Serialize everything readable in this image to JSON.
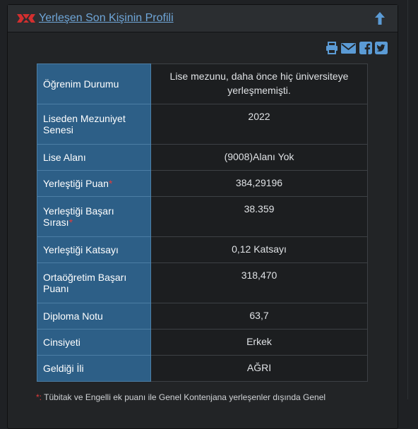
{
  "header": {
    "title": "Yerleşen Son Kişinin Profili"
  },
  "rows": [
    {
      "label": "Öğrenim Durumu",
      "star": "",
      "value": "Lise mezunu, daha önce hiç üniversiteye yerleşmemişti."
    },
    {
      "label": "Liseden Mezuniyet Senesi",
      "star": "",
      "value": "2022"
    },
    {
      "label": "Lise Alanı",
      "star": "",
      "value": "(9008)Alanı Yok"
    },
    {
      "label": "Yerleştiği Puan",
      "star": "*",
      "value": "384,29196"
    },
    {
      "label": "Yerleştiği Başarı Sırası",
      "star": "*",
      "value": "38.359"
    },
    {
      "label": "Yerleştiği Katsayı",
      "star": "",
      "value": "0,12 Katsayı"
    },
    {
      "label": "Ortaöğretim Başarı Puanı",
      "star": "",
      "value": "318,470"
    },
    {
      "label": "Diploma Notu",
      "star": "",
      "value": "63,7"
    },
    {
      "label": "Cinsiyeti",
      "star": "",
      "value": "Erkek"
    },
    {
      "label": "Geldiği İli",
      "star": "",
      "value": "AĞRI"
    }
  ],
  "footnote": {
    "star": "*:",
    "text": "Tübitak ve Engelli ek puanı ile Genel Kontenjana yerleşenler dışında Genel"
  },
  "icons": {
    "logo": "yok-logo-icon",
    "up": "arrow-up-icon",
    "share": [
      "print-icon",
      "envelope-icon",
      "facebook-icon",
      "twitter-icon"
    ]
  },
  "colors": {
    "label_bg": "#2d5f87",
    "link": "#6fa6d8",
    "share_icon": "#5b9bd5",
    "required_star": "#e23b3b"
  }
}
